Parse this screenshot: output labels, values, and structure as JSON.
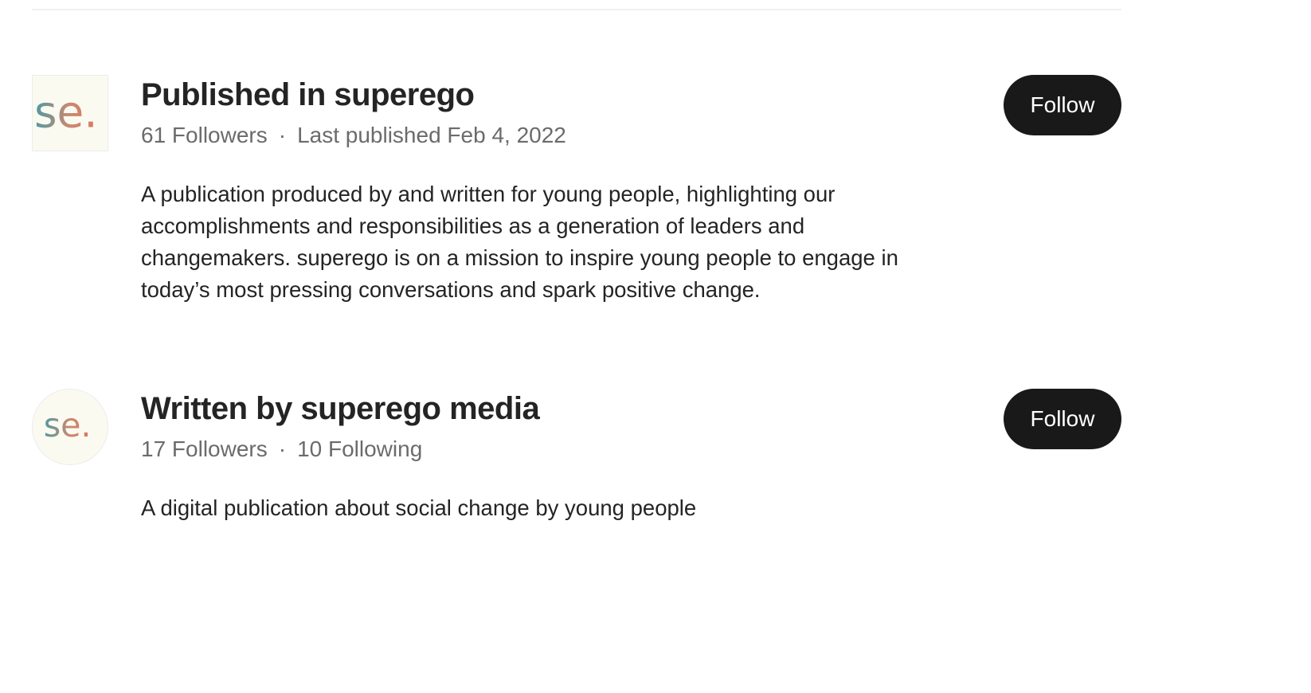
{
  "publication": {
    "logo_icon": "superego-se-logo-icon",
    "logo_text": "se.",
    "title": "Published in superego",
    "followers": "61 Followers",
    "separator": "·",
    "last_published": "Last published Feb 4, 2022",
    "description": "A publication produced by and written for young people, highlighting our accomplishments and responsibilities as a generation of leaders and changemakers. superego is on a mission to inspire young people to engage in today’s most pressing conversations and spark positive change.",
    "follow_label": "Follow"
  },
  "author": {
    "avatar_icon": "superego-se-avatar-icon",
    "avatar_text": "se.",
    "title": "Written by superego media",
    "followers": "17 Followers",
    "separator": "·",
    "following": "10 Following",
    "description": "A digital publication about social change by young people",
    "follow_label": "Follow"
  },
  "colors": {
    "button_bg": "#191919",
    "button_text": "#ffffff",
    "title_text": "#242424",
    "meta_text": "#6b6b6b",
    "avatar_bg": "#fbfaf1",
    "logo_gradient": [
      "#4d9aa6",
      "#d37a63",
      "#f0b84a"
    ]
  }
}
